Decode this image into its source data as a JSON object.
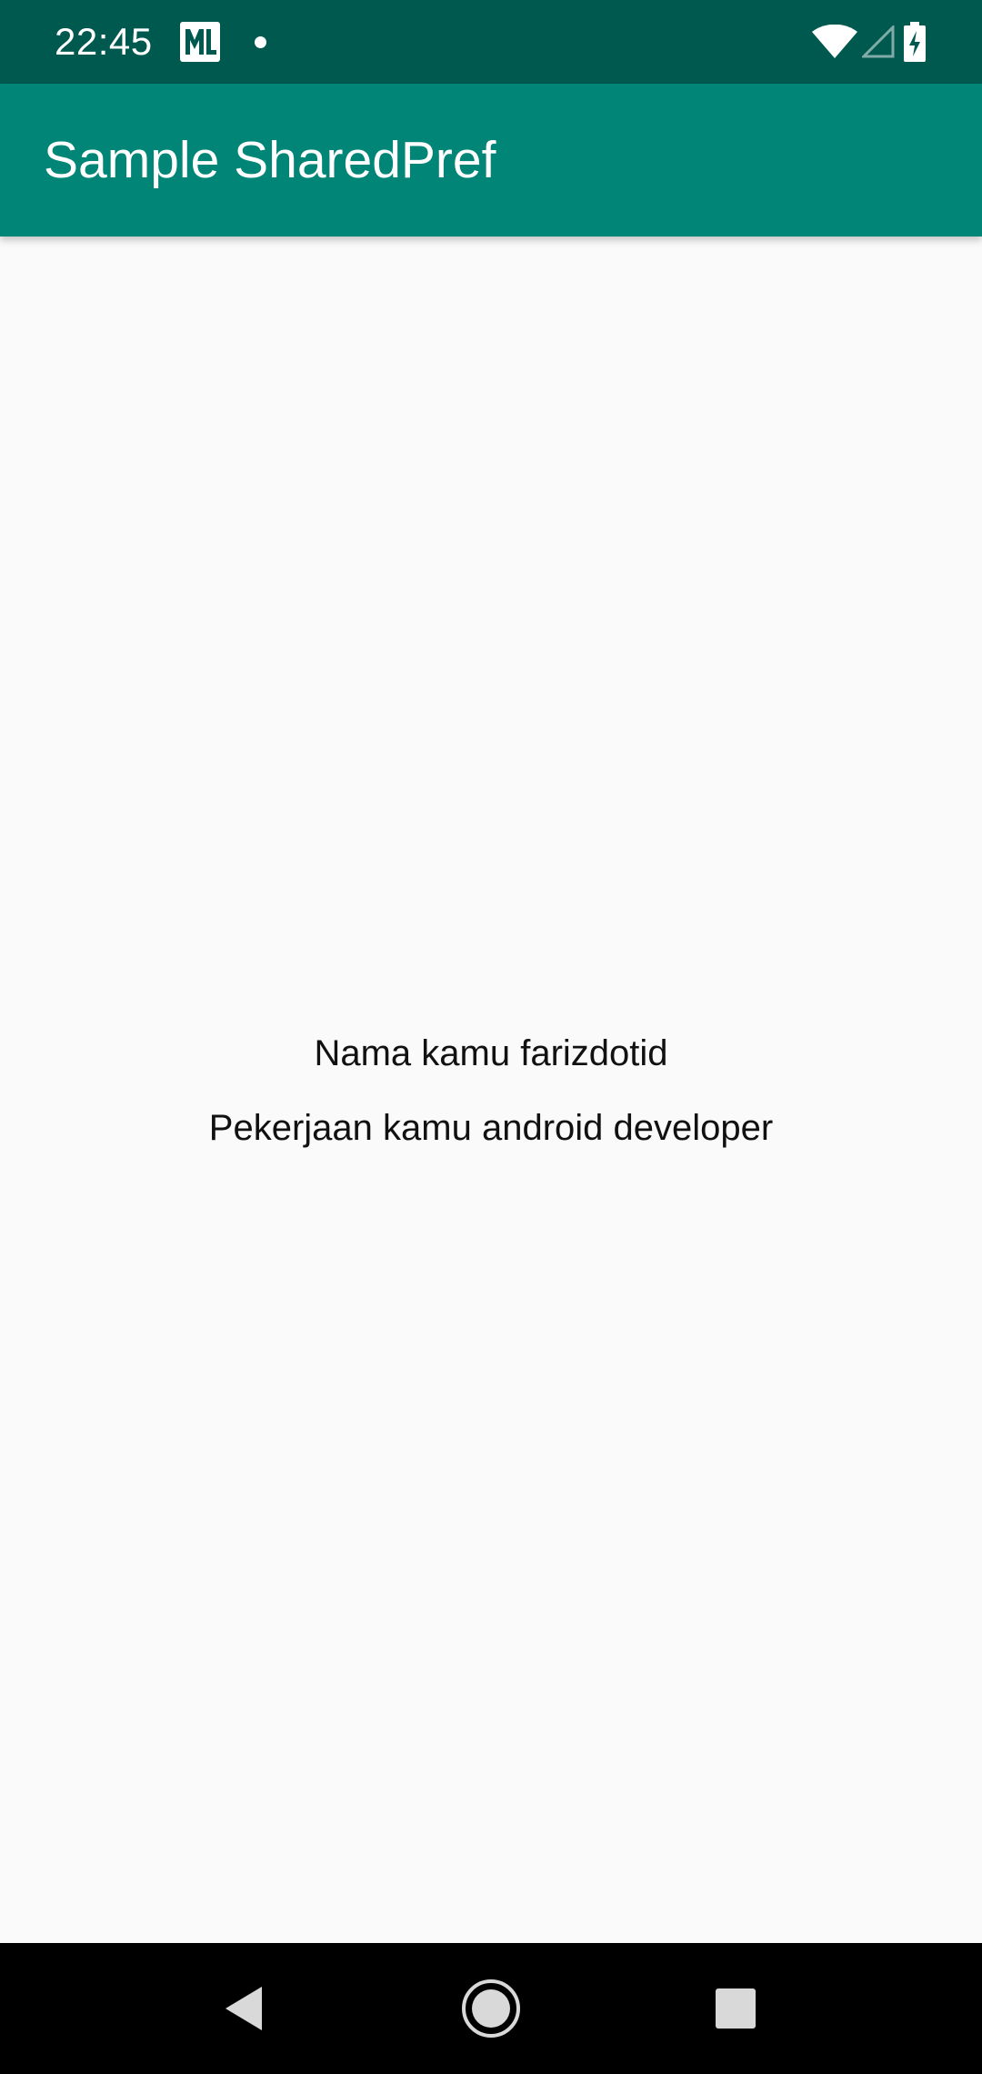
{
  "status_bar": {
    "time": "22:45",
    "notification_icons": [
      "ml-kit-icon",
      "notification-dot"
    ],
    "system_icons": [
      "wifi-icon",
      "cell-signal-icon",
      "battery-charging-icon"
    ]
  },
  "app_bar": {
    "title": "Sample SharedPref"
  },
  "content": {
    "name_text": "Nama kamu farizdotid",
    "job_text": "Pekerjaan kamu android developer"
  },
  "nav_bar": {
    "buttons": [
      "back-icon",
      "home-icon",
      "recents-icon"
    ]
  },
  "colors": {
    "status_bar": "#00594f",
    "app_bar": "#008577",
    "background": "#fafafa",
    "nav_bar": "#000000",
    "text": "#111111"
  }
}
